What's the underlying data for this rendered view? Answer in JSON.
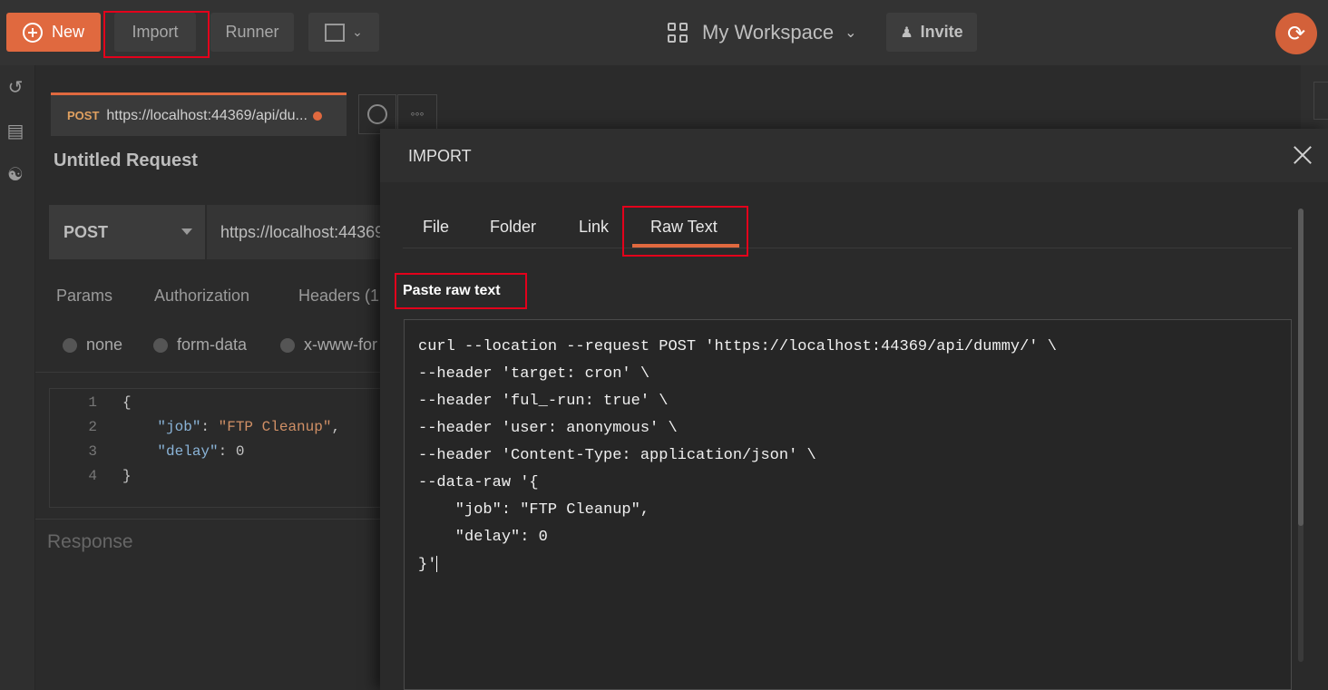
{
  "header": {
    "new_label": "New",
    "import_label": "Import",
    "runner_label": "Runner",
    "workspace_label": "My Workspace",
    "invite_label": "Invite"
  },
  "request_tab": {
    "method": "POST",
    "url": "https://localhost:44369/api/du..."
  },
  "request": {
    "title": "Untitled Request",
    "method": "POST",
    "url": "https://localhost:44369",
    "subtabs": [
      "Params",
      "Authorization",
      "Headers (1"
    ],
    "body_types": [
      "none",
      "form-data",
      "x-www-for"
    ],
    "body_lines": [
      {
        "n": "1",
        "text": "{"
      },
      {
        "n": "2",
        "key": "\"job\"",
        "value": "\"FTP Cleanup\""
      },
      {
        "n": "3",
        "key": "\"delay\"",
        "value": "0"
      },
      {
        "n": "4",
        "text": "}"
      }
    ],
    "response_label": "Response"
  },
  "import_modal": {
    "title": "IMPORT",
    "tabs": [
      "File",
      "Folder",
      "Link",
      "Raw Text"
    ],
    "active_tab": "Raw Text",
    "paste_label": "Paste raw text",
    "raw_lines": [
      "curl --location --request POST 'https://localhost:44369/api/dummy/' \\",
      "--header 'target: cron' \\",
      "--header 'ful_-run: true' \\",
      "--header 'user: anonymous' \\",
      "--header 'Content-Type: application/json' \\",
      "--data-raw '{",
      "    \"job\": \"FTP Cleanup\",",
      "    \"delay\": 0",
      "}'"
    ]
  },
  "colors": {
    "accent": "#e0693f",
    "highlight": "#e3001b"
  },
  "icons": [
    "plus-circle-icon",
    "new-window-icon",
    "grid-icon",
    "chevron-down-icon",
    "add-user-icon",
    "sync-icon",
    "history-icon",
    "collections-icon",
    "apis-icon",
    "close-icon",
    "ellipsis-icon"
  ]
}
